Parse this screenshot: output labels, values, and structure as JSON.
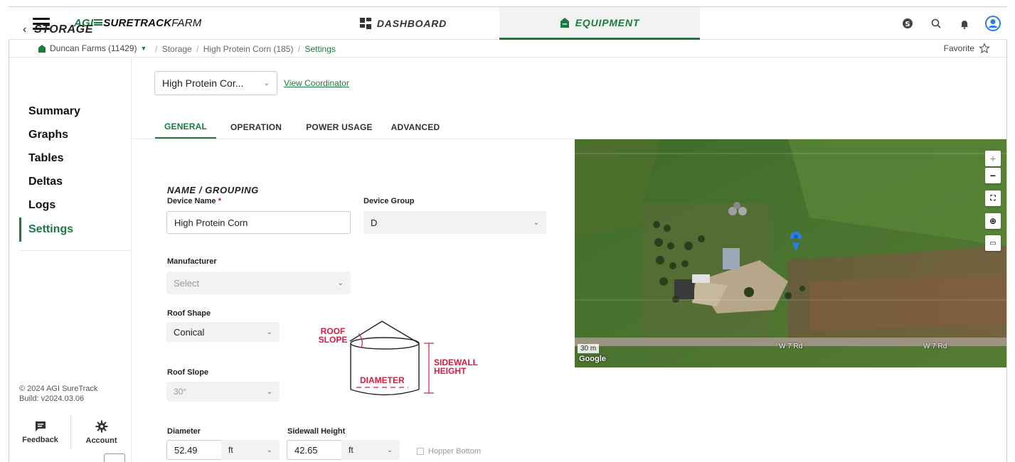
{
  "header": {
    "logo_agi": "AGI",
    "logo_sure": "SURETRACK",
    "logo_farm": "FARM",
    "nav": [
      {
        "label": "DASHBOARD",
        "icon": "dashboard-grid-icon",
        "active": false
      },
      {
        "label": "EQUIPMENT",
        "icon": "silo-icon",
        "active": true
      }
    ],
    "icons": [
      "subscription-s-icon",
      "search-icon",
      "bell-icon",
      "user-avatar-icon"
    ]
  },
  "breadcrumb": {
    "farm": "Duncan Farms (11429)",
    "path": [
      "Storage",
      "High Protein Corn (185)",
      "Settings"
    ],
    "favorite_label": "Favorite"
  },
  "sidebar": {
    "back_label": "STORAGE",
    "items": [
      {
        "label": "Summary",
        "active": false
      },
      {
        "label": "Graphs",
        "active": false
      },
      {
        "label": "Tables",
        "active": false
      },
      {
        "label": "Deltas",
        "active": false
      },
      {
        "label": "Logs",
        "active": false
      },
      {
        "label": "Settings",
        "active": true
      }
    ],
    "copyright": "© 2024 AGI SureTrack",
    "build": "Build: v2024.03.06",
    "footer": [
      {
        "label": "Feedback",
        "icon": "feedback-icon"
      },
      {
        "label": "Account",
        "icon": "gear-icon"
      }
    ]
  },
  "main": {
    "device_select": "High Protein Cor...",
    "view_coordinator": "View Coordinator",
    "tabs": [
      {
        "label": "GENERAL",
        "active": true
      },
      {
        "label": "OPERATION",
        "active": false
      },
      {
        "label": "POWER USAGE",
        "active": false
      },
      {
        "label": "ADVANCED",
        "active": false
      }
    ],
    "section_title": "NAME / GROUPING",
    "device_name_label": "Device Name",
    "required_mark": "*",
    "device_name_value": "High Protein Corn",
    "device_group_label": "Device Group",
    "device_group_value": "D",
    "manufacturer_label": "Manufacturer",
    "manufacturer_placeholder": "Select",
    "roof_shape_label": "Roof Shape",
    "roof_shape_value": "Conical",
    "roof_slope_label": "Roof Slope",
    "roof_slope_value": "30°",
    "diameter_label": "Diameter",
    "diameter_value": "52.49",
    "diameter_unit": "ft",
    "sidewall_label": "Sidewall Height",
    "sidewall_value": "42.65",
    "sidewall_unit": "ft",
    "hopper_label": "Hopper Bottom",
    "hopper_checked": false,
    "diagram": {
      "roof_slope": [
        "ROOF",
        "SLOPE"
      ],
      "sidewall_height": [
        "SIDEWALL",
        "HEIGHT"
      ],
      "diameter": "DIAMETER",
      "accent_color": "#d81b3f"
    }
  },
  "map": {
    "scale": "30 m",
    "attribution": "Google",
    "road_labels": [
      "W 7 Rd",
      "W 7 Rd"
    ],
    "controls": [
      "zoom-in-icon",
      "zoom-out-icon",
      "fullscreen-icon",
      "globe-icon",
      "ruler-icon"
    ]
  },
  "colors": {
    "brand_green": "#1a7a3f",
    "required_red": "#c8102e"
  }
}
